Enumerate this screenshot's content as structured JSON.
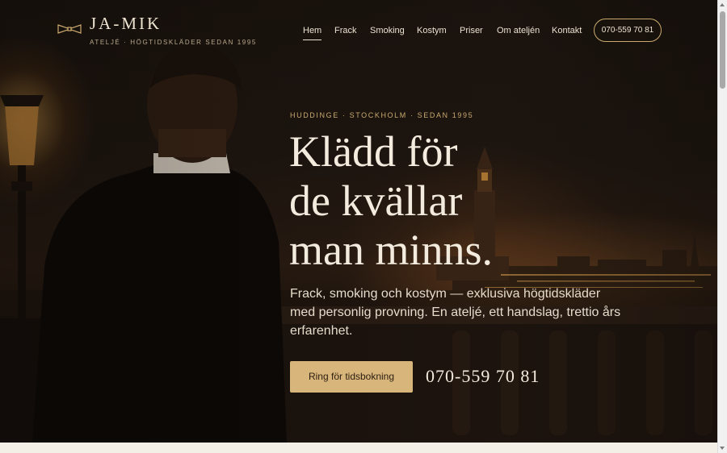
{
  "header": {
    "logo_name": "JA-MIK",
    "logo_tagline": "ATELJÉ · HÖGTIDSKLÄDER SEDAN 1995",
    "nav": [
      {
        "label": "Hem",
        "active": true
      },
      {
        "label": "Frack",
        "active": false
      },
      {
        "label": "Smoking",
        "active": false
      },
      {
        "label": "Kostym",
        "active": false
      },
      {
        "label": "Priser",
        "active": false
      },
      {
        "label": "Om ateljén",
        "active": false
      },
      {
        "label": "Kontakt",
        "active": false
      }
    ],
    "phone_button": "070-559 70 81"
  },
  "hero": {
    "eyebrow": "HUDDINGE · STOCKHOLM · SEDAN 1995",
    "headline_lines": [
      "Klädd för",
      "de kvällar",
      "man minns."
    ],
    "lede": "Frack, smoking och kostym — exklusiva högtidskläder med personlig provning. En ateljé, ett handslag, trettio års erfarenhet.",
    "cta_label": "Ring för tidsbokning",
    "cta_phone": "070-559 70 81"
  },
  "colors": {
    "accent_gold": "#d8b57a",
    "outline_gold": "#c9a96e",
    "text_light": "#f3ebdd",
    "background_dark": "#1a130e"
  },
  "icons": {
    "logo_mark": "bow-tie-icon"
  }
}
